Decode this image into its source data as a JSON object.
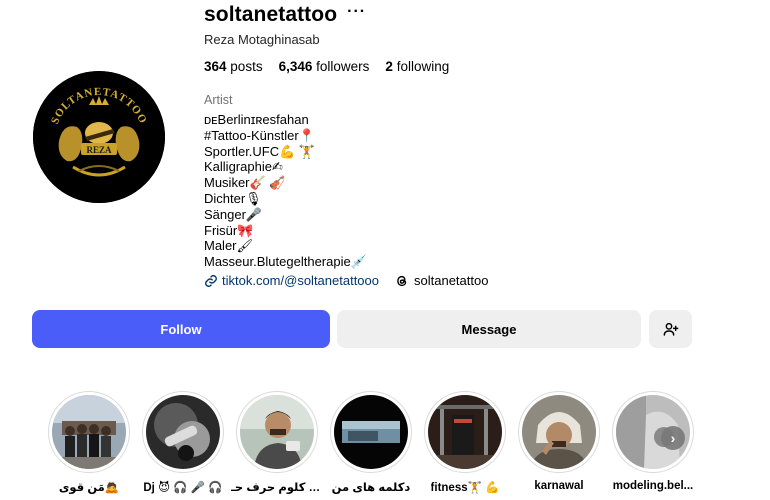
{
  "profile": {
    "username": "soltanetattoo",
    "full_name": "Reza Motaghinasab",
    "avatar_text_top": "SOLTANETATTOO",
    "avatar_text_bottom": "REZA",
    "stats": {
      "posts_count": "364",
      "posts_label": "posts",
      "followers_count": "6,346",
      "followers_label": "followers",
      "following_count": "2",
      "following_label": "following"
    },
    "category": "Artist",
    "bio_lines": [
      "ᴅᴇBerlinɪʀesfahan",
      "#Tattoo-Künstler📍",
      "Sportler.UFC💪 🏋",
      "Kalligraphie✍",
      "Musiker🎸 🎻",
      "Dichter🎙",
      "Sänger🎤",
      "Frisür🎀",
      "Maler🖌",
      "Masseur.Blutegeltherapie💉"
    ],
    "link_text": "tiktok.com/@soltanetattooo",
    "threads_text": "soltanetattoo"
  },
  "actions": {
    "follow_label": "Follow",
    "message_label": "Message",
    "suggest_icon": "person-add-icon"
  },
  "highlights": [
    {
      "label": "مَن قوی🙇"
    },
    {
      "label": "Dj 😈 🎧 🎤 🎧"
    },
    {
      "label": "دو کلوم حرف حـ..."
    },
    {
      "label": "دکلمه های من"
    },
    {
      "label": "fitness🏋 💪"
    },
    {
      "label": "karnawal"
    },
    {
      "label": "modeling.bel..."
    }
  ],
  "colors": {
    "follow_button": "#4a5df9",
    "secondary_button": "#efefef",
    "link": "#00376b",
    "avatar_gold": "#c9a227"
  }
}
